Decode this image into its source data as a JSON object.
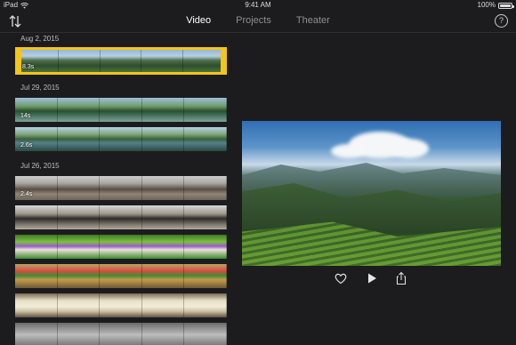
{
  "status_bar": {
    "device": "iPad",
    "time": "9:41 AM",
    "battery": "100%",
    "battery_level": 1.0
  },
  "nav": {
    "tabs": [
      {
        "label": "Video",
        "active": true
      },
      {
        "label": "Projects",
        "active": false
      },
      {
        "label": "Theater",
        "active": false
      }
    ],
    "help_label": "?"
  },
  "browser": {
    "groups": [
      {
        "date": "Aug 2, 2015",
        "clips": [
          {
            "duration": "8.3s",
            "selected": true,
            "look": "mtn"
          }
        ]
      },
      {
        "date": "Jul 29, 2015",
        "clips": [
          {
            "duration": "14s",
            "look": "riv"
          },
          {
            "duration": "2.6s",
            "look": "lake"
          }
        ]
      },
      {
        "date": "Jul 26, 2015",
        "clips": [
          {
            "duration": "2.4s",
            "look": "ppl"
          },
          {
            "duration": "",
            "look": "bike"
          },
          {
            "duration": "",
            "look": "veg"
          },
          {
            "duration": "",
            "look": "mkt"
          },
          {
            "duration": "",
            "look": "egg"
          },
          {
            "duration": "",
            "look": "tail"
          }
        ]
      }
    ]
  },
  "viewer": {
    "controls": [
      "heart-icon",
      "play-icon",
      "share-icon"
    ]
  },
  "colors": {
    "selection": "#f5c518",
    "background": "#1c1c1e",
    "tab_active": "#ffffff",
    "tab_inactive": "#8e8e93"
  }
}
